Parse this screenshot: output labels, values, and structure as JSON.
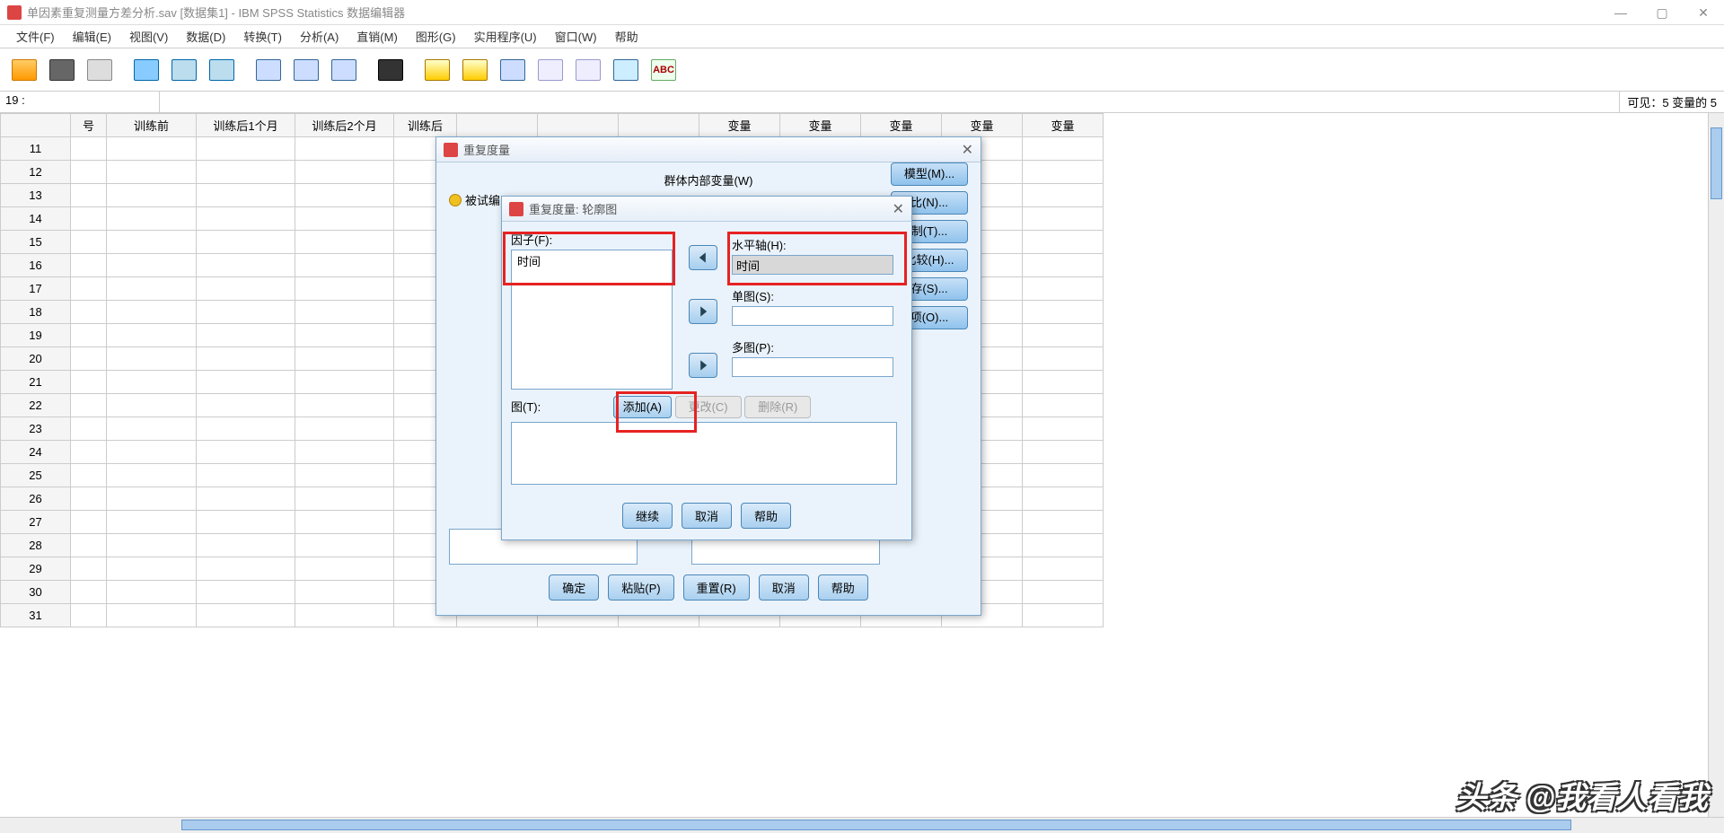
{
  "window": {
    "title": "单因素重复测量方差分析.sav [数据集1] - IBM SPSS Statistics 数据编辑器",
    "minimize": "—",
    "maximize": "▢",
    "close": "✕"
  },
  "menu": [
    "文件(F)",
    "编辑(E)",
    "视图(V)",
    "数据(D)",
    "转换(T)",
    "分析(A)",
    "直销(M)",
    "图形(G)",
    "实用程序(U)",
    "窗口(W)",
    "帮助"
  ],
  "namebar": {
    "cell": "19 :",
    "value": "",
    "visible": "可见：5 变量的 5"
  },
  "columns": [
    "号",
    "训练前",
    "训练后1个月",
    "训练后2个月",
    "训练后",
    "",
    "",
    "",
    "变量",
    "变量",
    "变量",
    "变量",
    "变量"
  ],
  "rowStart": 11,
  "rowCount": 21,
  "dialog1": {
    "title": "重复度量",
    "leftLabel": "被试编",
    "groupLabel": "群体内部变量(W)",
    "sideButtons": [
      "模型(M)...",
      "比(N)...",
      "制(T)...",
      "比较(H)...",
      "存(S)...",
      "项(O)..."
    ],
    "bottom": {
      "ok": "确定",
      "paste": "粘贴(P)",
      "reset": "重置(R)",
      "cancel": "取消",
      "help": "帮助"
    }
  },
  "dialog2": {
    "title": "重复度量: 轮廓图",
    "factorLabel": "因子(F):",
    "factorItem": "时间",
    "hAxisLabel": "水平轴(H):",
    "hAxisValue": "时间",
    "sepLinesLabel": "单图(S):",
    "sepPlotsLabel": "多图(P):",
    "plotsLabel": "图(T):",
    "addBtn": "添加(A)",
    "changeBtn": "更改(C)",
    "removeBtn": "删除(R)",
    "continue": "继续",
    "cancel": "取消",
    "help": "帮助"
  },
  "watermark": "头条 @我看人看我"
}
